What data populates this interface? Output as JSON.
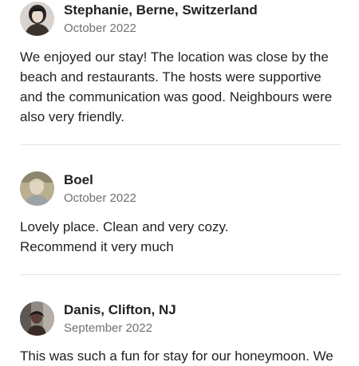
{
  "reviews": [
    {
      "name": "Stephanie, Berne, Switzerland",
      "date": "October 2022",
      "text": "We enjoyed our stay! The location was close by the beach and restaurants. The hosts were supportive and the communication was good. Neighbours were also very friendly.",
      "avatar_icon": "user-avatar-photo"
    },
    {
      "name": "Boel",
      "date": "October 2022",
      "text": "Lovely place. Clean and very cozy.\nRecommend it very much",
      "avatar_icon": "user-avatar-photo"
    },
    {
      "name": "Danis, Clifton, NJ",
      "date": "September 2022",
      "text": "This was such a fun for stay for our honeymoon. We",
      "avatar_icon": "user-avatar-photo"
    }
  ]
}
